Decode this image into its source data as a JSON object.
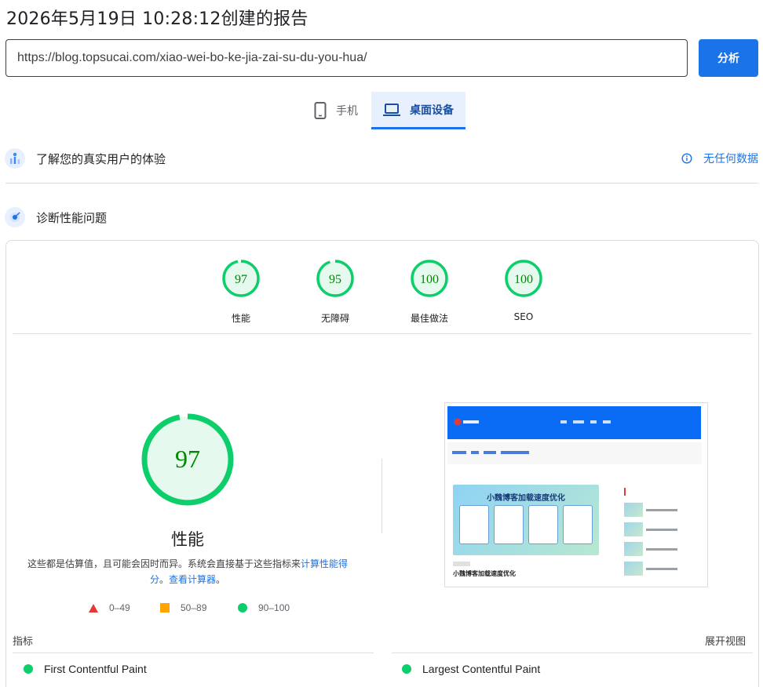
{
  "report": {
    "title": "2026年5月19日 10:28:12创建的报告"
  },
  "search": {
    "url_value": "https://blog.topsucai.com/xiao-wei-bo-ke-jia-zai-su-du-you-hua/",
    "analyze_label": "分析"
  },
  "device_tabs": [
    {
      "label": "手机",
      "icon": "smartphone-icon",
      "selected": false
    },
    {
      "label": "桌面设备",
      "icon": "laptop-icon",
      "selected": true
    }
  ],
  "field_section": {
    "title": "了解您的真实用户的体验",
    "status": "无任何数据",
    "icon": "users-chart-icon",
    "status_icon": "info-icon"
  },
  "lab_section": {
    "title": "诊断性能问题",
    "icon": "lighthouse-icon"
  },
  "categories": [
    {
      "score": "97",
      "label": "性能"
    },
    {
      "score": "95",
      "label": "无障碍"
    },
    {
      "score": "100",
      "label": "最佳做法"
    },
    {
      "score": "100",
      "label": "SEO"
    }
  ],
  "performance": {
    "score": "97",
    "score_value": 97,
    "label": "性能",
    "note_text": "这些都是估算值，且可能会因时而异。系统会直接基于这些指标来",
    "note_link1": "计算性能得分",
    "note_sep": "。",
    "note_link2": "查看计算器",
    "note_end": "。"
  },
  "legend": [
    {
      "range": "0–49",
      "shape": "triangle",
      "color": "#e53935"
    },
    {
      "range": "50–89",
      "shape": "square",
      "color": "#ffa400"
    },
    {
      "range": "90–100",
      "shape": "circle",
      "color": "#0cce6b"
    }
  ],
  "screenshot_preview": {
    "banner_title": "小魏博客加载速度优化",
    "post_title": "小魏博客加载速度优化"
  },
  "metrics": {
    "header": "指标",
    "expand_label": "展开视图",
    "items": [
      {
        "name": "First Contentful Paint",
        "status_color": "#0cce6b"
      },
      {
        "name": "Largest Contentful Paint",
        "status_color": "#0cce6b"
      }
    ]
  },
  "colors": {
    "accent": "#1a73e8",
    "pass": "#0cce6b",
    "pass_fill": "#e6f9ee",
    "pass_text": "#008800"
  }
}
